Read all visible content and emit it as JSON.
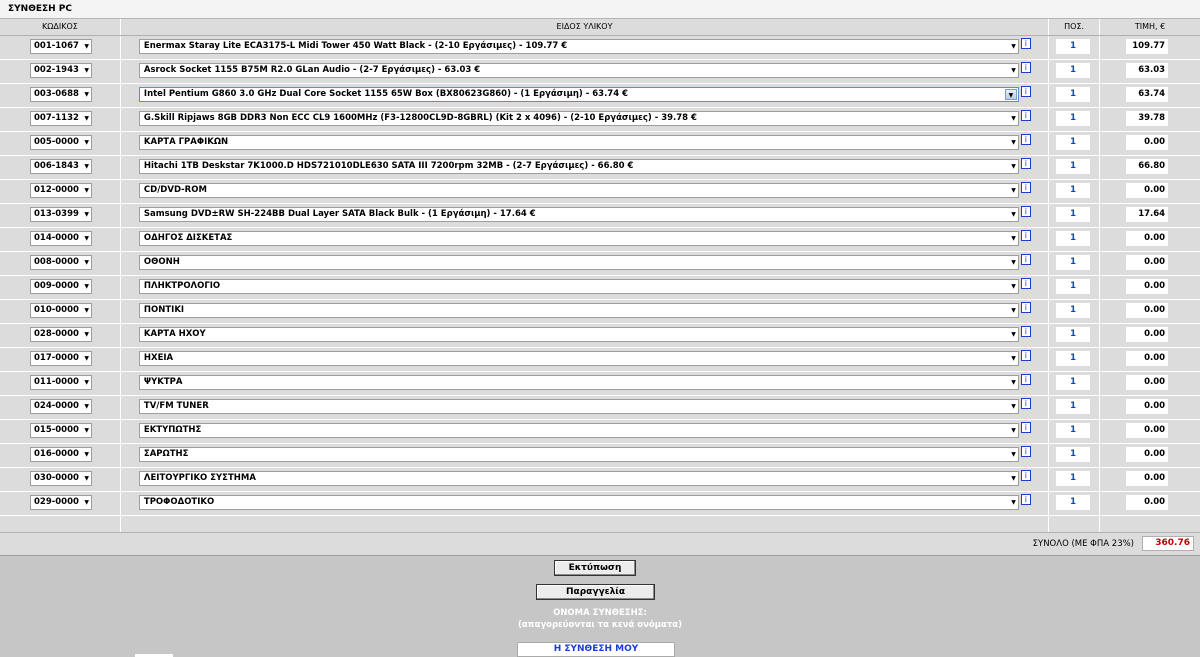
{
  "title": "ΣΥΝΘΕΣΗ PC",
  "headers": {
    "code": "ΚΩΔΙΚΟΣ",
    "description": "ΕΙΔΟΣ ΥΛΙΚΟΥ",
    "qty": "ΠΟΣ.",
    "price": "ΤΙΜΗ, €"
  },
  "info_glyph": "i",
  "dropdown_glyph": "▼",
  "rows": [
    {
      "code": "001-1067",
      "description": "Enermax Staray Lite ECA3175-L Midi Tower 450 Watt Black - (2-10 Εργάσιμες) - 109.77 €",
      "qty": "1",
      "price": "109.77"
    },
    {
      "code": "002-1943",
      "description": "Asrock Socket 1155 B75M R2.0 GLan Audio - (2-7 Εργάσιμες) - 63.03 €",
      "qty": "1",
      "price": "63.03"
    },
    {
      "code": "003-0688",
      "description": "Intel Pentium G860 3.0 GHz Dual Core Socket 1155 65W Box (BX80623G860) - (1 Εργάσιμη) - 63.74 €",
      "qty": "1",
      "price": "63.74",
      "active": true
    },
    {
      "code": "007-1132",
      "description": "G.Skill Ripjaws 8GB DDR3 Non ECC CL9 1600MHz (F3-12800CL9D-8GBRL) (Kit 2 x 4096) - (2-10 Εργάσιμες) - 39.78 €",
      "qty": "1",
      "price": "39.78"
    },
    {
      "code": "005-0000",
      "description": "ΚΑΡΤΑ ΓΡΑΦΙΚΩΝ",
      "qty": "1",
      "price": "0.00"
    },
    {
      "code": "006-1843",
      "description": "Hitachi 1TB Deskstar 7K1000.D HDS721010DLE630 SATA III 7200rpm 32MB - (2-7 Εργάσιμες) - 66.80 €",
      "qty": "1",
      "price": "66.80"
    },
    {
      "code": "012-0000",
      "description": "CD/DVD-ROM",
      "qty": "1",
      "price": "0.00"
    },
    {
      "code": "013-0399",
      "description": "Samsung DVD±RW SH-224BB Dual Layer SATA Black Bulk - (1 Εργάσιμη) - 17.64 €",
      "qty": "1",
      "price": "17.64"
    },
    {
      "code": "014-0000",
      "description": "ΟΔΗΓΟΣ ΔΙΣΚΕΤΑΣ",
      "qty": "1",
      "price": "0.00"
    },
    {
      "code": "008-0000",
      "description": "ΟΘΟΝΗ",
      "qty": "1",
      "price": "0.00"
    },
    {
      "code": "009-0000",
      "description": "ΠΛΗΚΤΡΟΛΟΓΙΟ",
      "qty": "1",
      "price": "0.00"
    },
    {
      "code": "010-0000",
      "description": "ΠΟΝΤΙΚΙ",
      "qty": "1",
      "price": "0.00"
    },
    {
      "code": "028-0000",
      "description": "ΚΑΡΤΑ ΗΧΟΥ",
      "qty": "1",
      "price": "0.00"
    },
    {
      "code": "017-0000",
      "description": "ΗΧΕΙΑ",
      "qty": "1",
      "price": "0.00"
    },
    {
      "code": "011-0000",
      "description": "ΨΥΚΤΡΑ",
      "qty": "1",
      "price": "0.00"
    },
    {
      "code": "024-0000",
      "description": "TV/FM TUNER",
      "qty": "1",
      "price": "0.00"
    },
    {
      "code": "015-0000",
      "description": "ΕΚΤΥΠΩΤΗΣ",
      "qty": "1",
      "price": "0.00"
    },
    {
      "code": "016-0000",
      "description": "ΣΑΡΩΤΗΣ",
      "qty": "1",
      "price": "0.00"
    },
    {
      "code": "030-0000",
      "description": "ΛΕΙΤΟΥΡΓΙΚΟ ΣΥΣΤΗΜΑ",
      "qty": "1",
      "price": "0.00"
    },
    {
      "code": "029-0000",
      "description": "ΤΡΟΦΟΔΟΤΙΚΟ",
      "qty": "1",
      "price": "0.00"
    }
  ],
  "total": {
    "label": "ΣΥΝΟΛΟ (ΜΕ ΦΠΑ 23%)",
    "value": "360.76"
  },
  "actions": {
    "print_label": "Εκτύπωση",
    "order_label": "Παραγγελία",
    "composition_name_label": "ΟΝΟΜΑ ΣΥΝΘΕΣΗΣ:",
    "composition_name_hint": "(απαγορεύονται τα κενά ονόματα)",
    "composition_name_value": "Η ΣΥΝΘΕΣΗ ΜΟΥ"
  },
  "colors": {
    "total_value": "#c00000",
    "qty_text": "#1a3dd6",
    "background": "#c6c6c6"
  }
}
